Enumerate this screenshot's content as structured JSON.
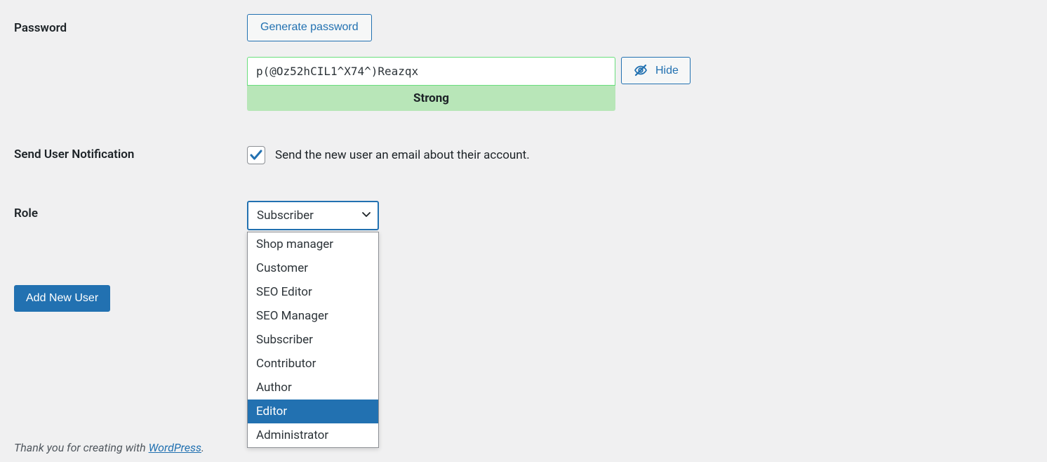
{
  "password": {
    "label": "Password",
    "generate_button": "Generate password",
    "value": "p(@Oz52hCIL1^X74^)Reazqx",
    "strength": "Strong",
    "hide_button": "Hide"
  },
  "notification": {
    "label": "Send User Notification",
    "checked": true,
    "description": "Send the new user an email about their account."
  },
  "role": {
    "label": "Role",
    "selected": "Subscriber",
    "options": [
      "Shop manager",
      "Customer",
      "SEO Editor",
      "SEO Manager",
      "Subscriber",
      "Contributor",
      "Author",
      "Editor",
      "Administrator"
    ],
    "highlighted_index": 7
  },
  "submit": {
    "label": "Add New User"
  },
  "footer": {
    "prefix": "Thank you for creating with ",
    "link_text": "WordPress",
    "suffix": "."
  }
}
